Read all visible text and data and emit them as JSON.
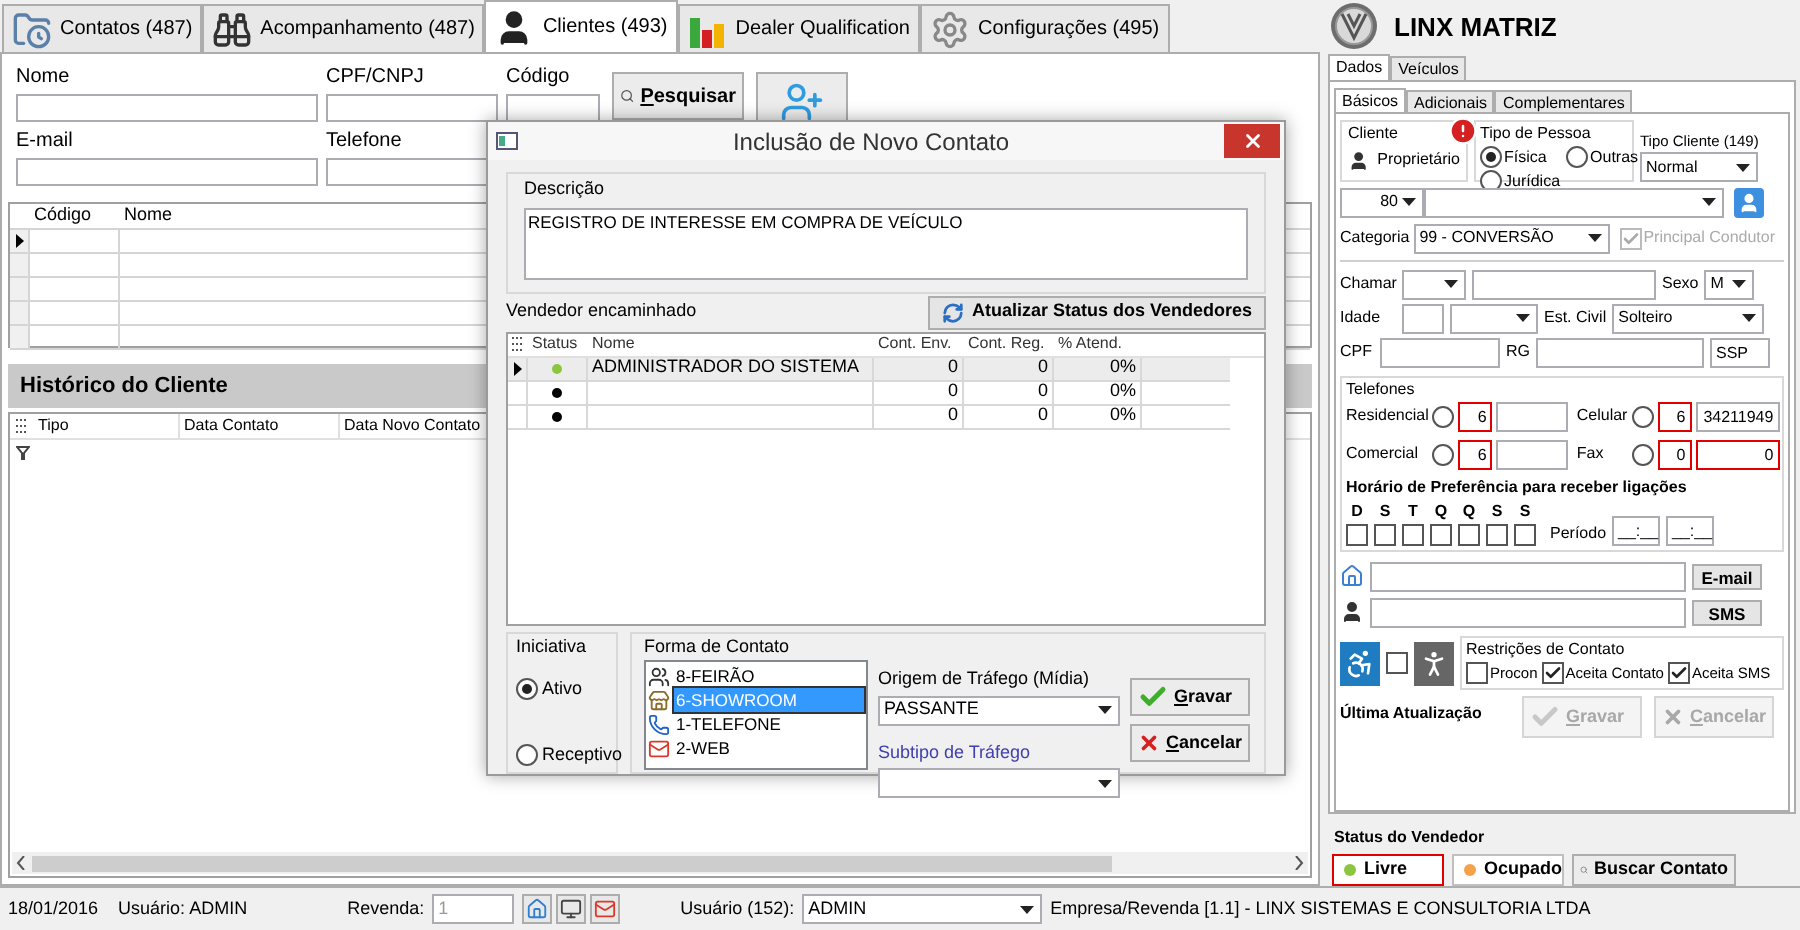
{
  "tabs": [
    {
      "label": "Contatos (487)",
      "selected": false
    },
    {
      "label": "Acompanhamento (487)",
      "selected": false
    },
    {
      "label": "Clientes (493)",
      "selected": true
    },
    {
      "label": "Dealer Qualification",
      "selected": false
    },
    {
      "label": "Configurações (495)",
      "selected": false
    }
  ],
  "search_form": {
    "fields": [
      {
        "label": "Nome"
      },
      {
        "label": "CPF/CNPJ"
      },
      {
        "label": "Código"
      },
      {
        "label": "E-mail"
      },
      {
        "label": "Telefone"
      }
    ],
    "search_button": "Pesquisar"
  },
  "clients_grid": {
    "columns": [
      "Código",
      "Nome"
    ],
    "rows": [
      {
        "selected": true
      },
      {
        "selected": false
      },
      {
        "selected": false
      },
      {
        "selected": false
      },
      {
        "selected": false
      }
    ]
  },
  "history": {
    "title": "Histórico do Cliente",
    "columns": [
      "Tipo",
      "Data Contato",
      "Data Novo Contato"
    ]
  },
  "dialog": {
    "title": "Inclusão de Novo Contato",
    "description_label": "Descrição",
    "description": "REGISTRO DE INTERESSE EM COMPRA DE VEÍCULO",
    "vendors_label": "Vendedor encaminhado",
    "refresh_button": "Atualizar Status dos Vendedores",
    "vendors": {
      "columns": [
        "Status",
        "Nome",
        "Cont. Env.",
        "Cont. Reg.",
        "% Atend."
      ],
      "rows": [
        {
          "color": "#8cc63f",
          "name": "ADMINISTRADOR DO SISTEMA",
          "sent": "0",
          "registered": "0",
          "rate": "0%",
          "selected": true
        },
        {
          "color": "#000000",
          "sent": "0",
          "registered": "0",
          "rate": "0%",
          "selected": false
        },
        {
          "color": "#000000",
          "sent": "0",
          "registered": "0",
          "rate": "0%",
          "selected": false
        }
      ]
    },
    "initiative": {
      "label": "Iniciativa",
      "options": [
        {
          "label": "Ativo",
          "selected": true
        },
        {
          "label": "Receptivo",
          "selected": false
        }
      ]
    },
    "contact_form": {
      "label": "Forma de Contato",
      "items": [
        {
          "label": "8-FEIRÃO",
          "selected": false
        },
        {
          "label": "6-SHOWROOM",
          "selected": true
        },
        {
          "label": "1-TELEFONE",
          "selected": false
        },
        {
          "label": "2-WEB",
          "selected": false
        }
      ]
    },
    "traffic_origin": {
      "label": "Origem de Tráfego (Mídia)",
      "value": "PASSANTE"
    },
    "traffic_subtype": {
      "label": "Subtipo de Tráfego"
    },
    "buttons": [
      "Gravar",
      "Cancelar"
    ]
  },
  "customer_panel": {
    "title": "LINX MATRIZ",
    "tabs": [
      {
        "label": "Dados",
        "selected": true
      },
      {
        "label": "Veículos",
        "selected": false
      }
    ],
    "subtabs": [
      {
        "label": "Básicos",
        "selected": true
      },
      {
        "label": "Adicionais",
        "selected": false
      },
      {
        "label": "Complementares",
        "selected": false
      }
    ],
    "cliente": {
      "label": "Cliente",
      "role": "Proprietário"
    },
    "person_type": {
      "label": "Tipo de Pessoa",
      "options": [
        {
          "label": "Física",
          "selected": true
        },
        {
          "label": "Outras",
          "selected": false
        },
        {
          "label": "Jurídica",
          "selected": false
        }
      ]
    },
    "client_type": {
      "label": "Tipo Cliente (149)",
      "value": "Normal"
    },
    "prefix_select": "80",
    "categoria": {
      "label": "Categoria",
      "value": "99 - CONVERSÃO"
    },
    "principal_condutor": {
      "label": "Principal Condutor",
      "checked": true,
      "disabled": true
    },
    "chamar_label": "Chamar",
    "sexo": {
      "label": "Sexo",
      "value": "M"
    },
    "idade_label": "Idade",
    "est_civil": {
      "label": "Est. Civil",
      "value": "Solteiro"
    },
    "cpf_label": "CPF",
    "rg_label": "RG",
    "rg_issuer": "SSP",
    "phones": {
      "label": "Telefones",
      "items": [
        {
          "label": "Residencial",
          "selected": false,
          "area": "6",
          "area_error": true,
          "number_error": false
        },
        {
          "label": "Celular",
          "selected": false,
          "area": "6",
          "number": "34211949",
          "area_error": true,
          "number_error": false
        },
        {
          "label": "Comercial",
          "selected": false,
          "area": "6",
          "area_error": true,
          "number_error": false
        },
        {
          "label": "Fax",
          "selected": false,
          "area": "0",
          "number": "0",
          "area_error": true,
          "number_error": true
        }
      ]
    },
    "schedule": {
      "title": "Horário de Preferência para receber ligações",
      "days": [
        {
          "label": "D",
          "checked": false
        },
        {
          "label": "S",
          "checked": false
        },
        {
          "label": "T",
          "checked": false
        },
        {
          "label": "Q",
          "checked": false
        },
        {
          "label": "Q",
          "checked": false
        },
        {
          "label": "S",
          "checked": false
        },
        {
          "label": "S",
          "checked": false
        }
      ],
      "period_label": "Período",
      "period_from": "__:__",
      "period_to": "__:__"
    },
    "email_button": "E-mail",
    "sms_button": "SMS",
    "accessibility_checked": false,
    "restrictions": {
      "label": "Restrições de Contato",
      "items": [
        {
          "label": "Procon",
          "checked": false
        },
        {
          "label": "Aceita Contato",
          "checked": true
        },
        {
          "label": "Aceita SMS",
          "checked": true
        }
      ]
    },
    "last_update_label": "Última Atualização",
    "buttons": [
      {
        "label": "Gravar",
        "disabled": true
      },
      {
        "label": "Cancelar",
        "disabled": true
      }
    ],
    "vendor_status": {
      "label": "Status do Vendedor",
      "options": [
        {
          "label": "Livre",
          "color": "#8cc63f",
          "selected": true
        },
        {
          "label": "Ocupado",
          "color": "#f7a24b",
          "selected": false
        }
      ],
      "search_button": "Buscar Contato"
    }
  },
  "status_bar": {
    "date": "18/01/2016",
    "user": "Usuário: ADMIN",
    "revenda_label": "Revenda:",
    "revenda_value": "1",
    "user_select_label": "Usuário (152):",
    "user_select_value": "ADMIN",
    "company": "Empresa/Revenda [1.1] - LINX SISTEMAS E CONSULTORIA LTDA"
  }
}
